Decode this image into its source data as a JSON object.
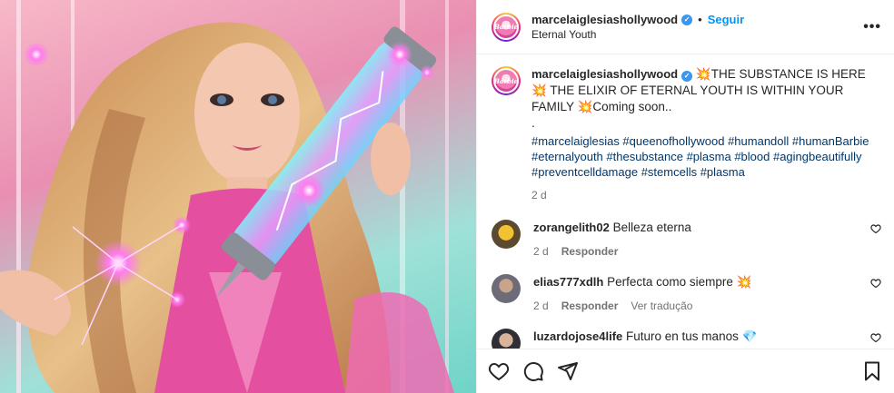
{
  "post": {
    "username": "marcelaiglesiashollywood",
    "follow_label": "Seguir",
    "location": "Eternal Youth",
    "avatar_logo": "Barbie",
    "caption": {
      "text": "💥THE SUBSTANCE IS HERE💥 THE ELIXIR OF ETERNAL YOUTH IS WITHIN YOUR FAMILY 💥Coming soon..",
      "dot_line": ".",
      "hashtags": "#marcelaiglesias #queenofhollywood #humandoll #humanBarbie #eternalyouth #thesubstance #plasma #blood #agingbeautifully #preventcelldamage #stemcells #plasma",
      "age": "2 d"
    }
  },
  "comments": [
    {
      "username": "zorangelith02",
      "text": "Belleza eterna",
      "age": "2 d",
      "reply_label": "Responder",
      "translate_label": ""
    },
    {
      "username": "elias777xdlh",
      "text": "Perfecta como siempre 💥",
      "age": "2 d",
      "reply_label": "Responder",
      "translate_label": "Ver tradução"
    },
    {
      "username": "luzardojose4life",
      "text": "Futuro en tus manos 💎",
      "age": "",
      "reply_label": "",
      "translate_label": ""
    }
  ],
  "icons": {
    "like": "heart-icon",
    "comment": "comment-icon",
    "share": "share-icon",
    "save": "bookmark-icon",
    "more": "more-options-icon",
    "verified": "verified-badge-icon"
  },
  "colors": {
    "accent": "#0095f6",
    "hashtag": "#00376b",
    "muted": "#737373",
    "verified": "#3897f0"
  }
}
